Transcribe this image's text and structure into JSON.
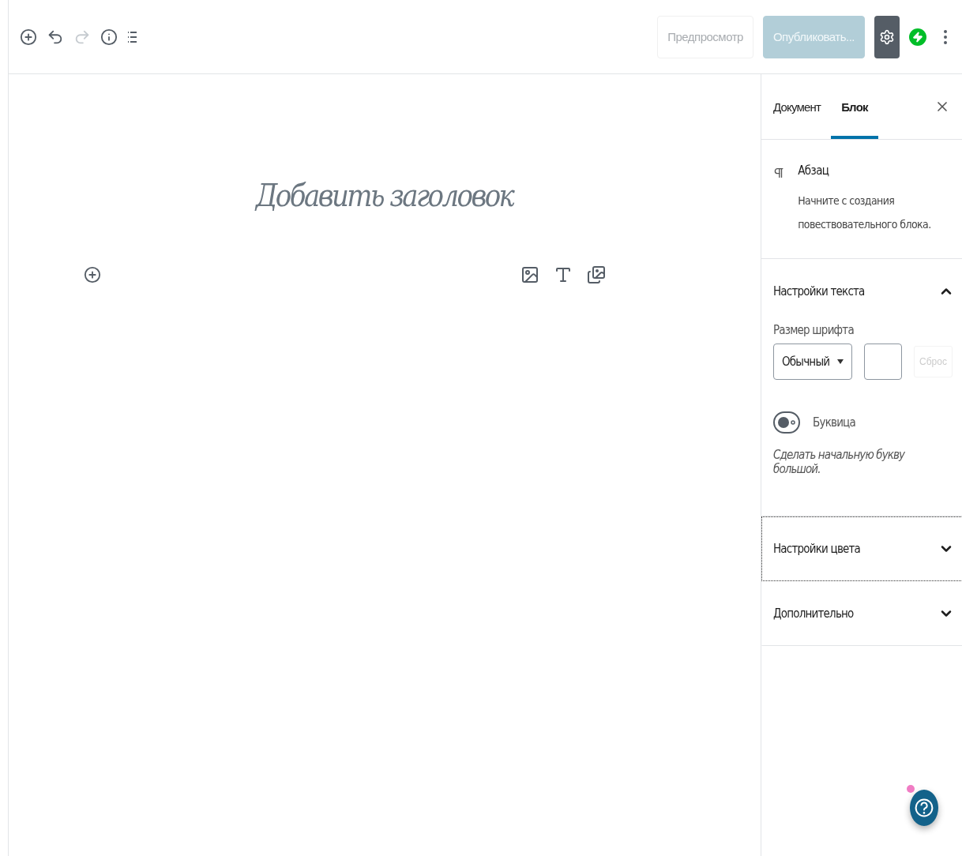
{
  "toolbar": {
    "tools": [
      {
        "kind": "add",
        "disabled": false
      },
      {
        "kind": "undo",
        "disabled": false
      },
      {
        "kind": "redo",
        "disabled": true
      },
      {
        "kind": "info",
        "disabled": false
      },
      {
        "kind": "outline",
        "disabled": false
      }
    ],
    "preview": {
      "label": "Предпросмотр",
      "disabled": true
    },
    "publish": {
      "label": "Опубликовать...",
      "disabled": true
    },
    "settings": {
      "selected": true
    }
  },
  "editor": {
    "title_placeholder": "Добавить заголовок",
    "inserters": [
      {
        "kind": "image"
      },
      {
        "kind": "text"
      },
      {
        "kind": "gallery"
      }
    ]
  },
  "sidebar": {
    "tabs": [
      {
        "label": "Документ",
        "selected": false
      },
      {
        "label": "Блок",
        "selected": true
      }
    ],
    "block": {
      "name": "Абзац",
      "description": "Начните с создания повествовательного блока."
    },
    "panels": [
      {
        "title": "Настройки текста",
        "expanded": true,
        "focused": false,
        "font_size": {
          "label": "Размер шрифта",
          "value": "Обычный",
          "reset": "Сброс"
        },
        "toggle": {
          "label": "Буквица",
          "on": false,
          "help": "Сделать начальную букву большой."
        }
      },
      {
        "title": "Настройки цвета",
        "expanded": false,
        "focused": true
      },
      {
        "title": "Дополнительно",
        "expanded": false,
        "focused": false
      }
    ]
  },
  "help": {
    "unread": true
  }
}
